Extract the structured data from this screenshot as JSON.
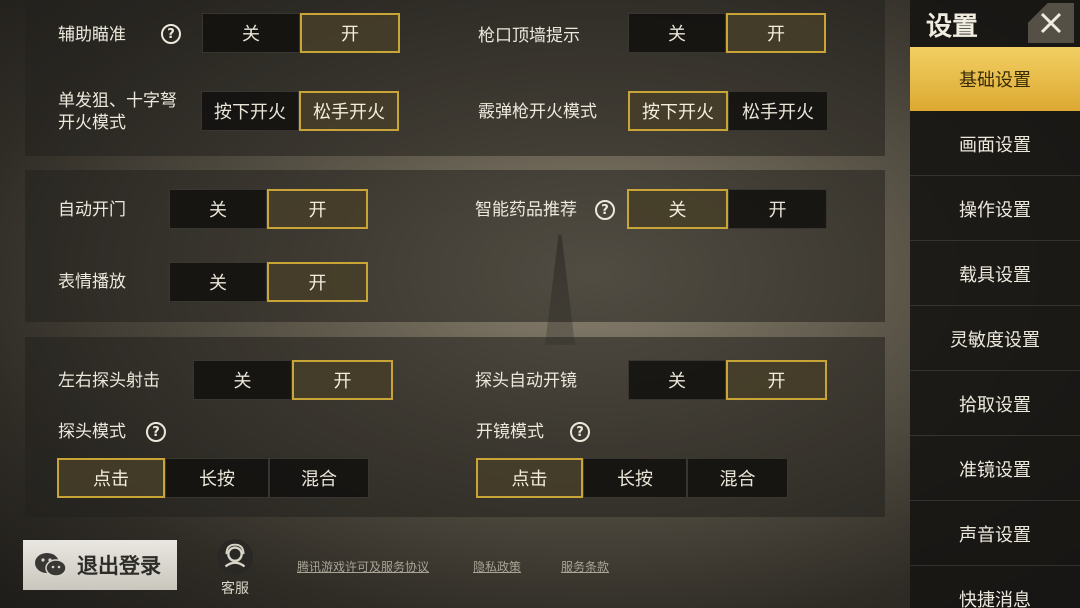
{
  "panel1": {
    "aim_assist": {
      "label": "辅助瞄准",
      "off": "关",
      "on": "开",
      "selected": "on"
    },
    "muzzle_hint": {
      "label": "枪口顶墙提示",
      "off": "关",
      "on": "开",
      "selected": "on"
    },
    "single_fire": {
      "label_line1": "单发狙、十字弩",
      "label_line2": "开火模式",
      "press": "按下开火",
      "release": "松手开火",
      "selected": "release"
    },
    "shotgun_fire": {
      "label": "霰弹枪开火模式",
      "press": "按下开火",
      "release": "松手开火",
      "selected": "press"
    }
  },
  "panel2": {
    "auto_door": {
      "label": "自动开门",
      "off": "关",
      "on": "开",
      "selected": "on"
    },
    "smart_meds": {
      "label": "智能药品推荐",
      "off": "关",
      "on": "开",
      "selected": "off"
    },
    "emote": {
      "label": "表情播放",
      "off": "关",
      "on": "开",
      "selected": "on"
    }
  },
  "panel3": {
    "lean_fire": {
      "label": "左右探头射击",
      "off": "关",
      "on": "开",
      "selected": "on"
    },
    "lean_scope": {
      "label": "探头自动开镜",
      "off": "关",
      "on": "开",
      "selected": "on"
    },
    "lean_mode": {
      "label": "探头模式",
      "tap": "点击",
      "hold": "长按",
      "mixed": "混合",
      "selected": "tap"
    },
    "scope_mode": {
      "label": "开镜模式",
      "tap": "点击",
      "hold": "长按",
      "mixed": "混合",
      "selected": "tap"
    }
  },
  "sidebar": {
    "title": "设置",
    "items": [
      {
        "label": "基础设置",
        "active": true
      },
      {
        "label": "画面设置"
      },
      {
        "label": "操作设置"
      },
      {
        "label": "载具设置"
      },
      {
        "label": "灵敏度设置"
      },
      {
        "label": "拾取设置"
      },
      {
        "label": "准镜设置"
      },
      {
        "label": "声音设置"
      },
      {
        "label": "快捷消息"
      }
    ]
  },
  "footer": {
    "logout": "退出登录",
    "service": "客服",
    "link_license": "腾讯游戏许可及服务协议",
    "link_privacy": "隐私政策",
    "link_terms": "服务条款"
  },
  "colors": {
    "accent_gold": "#c9a436",
    "active_tab": "#e8bb45"
  }
}
